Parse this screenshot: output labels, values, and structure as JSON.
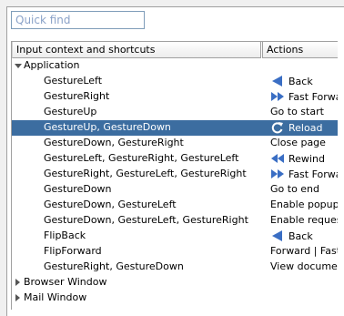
{
  "search": {
    "placeholder": "Quick find"
  },
  "columns": {
    "context": "Input context and shortcuts",
    "actions": "Actions"
  },
  "groups": {
    "application": "Application",
    "browser_window": "Browser Window",
    "mail_window": "Mail Window"
  },
  "rows": [
    {
      "gesture": "GestureLeft",
      "icon": "back-arrow-icon",
      "action": "Back"
    },
    {
      "gesture": "GestureRight",
      "icon": "fast-forward-icon",
      "action": "Fast Forward"
    },
    {
      "gesture": "GestureUp",
      "icon": "",
      "action": "Go to start"
    },
    {
      "gesture": "GestureUp, GestureDown",
      "icon": "reload-icon",
      "action": "Reload"
    },
    {
      "gesture": "GestureDown, GestureRight",
      "icon": "",
      "action": "Close page"
    },
    {
      "gesture": "GestureLeft, GestureRight, GestureLeft",
      "icon": "rewind-icon",
      "action": "Rewind"
    },
    {
      "gesture": "GestureRight, GestureLeft, GestureRight",
      "icon": "fast-forward-icon",
      "action": "Fast Forward"
    },
    {
      "gesture": "GestureDown",
      "icon": "",
      "action": "Go to end"
    },
    {
      "gesture": "GestureDown, GestureLeft",
      "icon": "",
      "action": "Enable popup"
    },
    {
      "gesture": "GestureDown, GestureLeft, GestureRight",
      "icon": "",
      "action": "Enable request"
    },
    {
      "gesture": "FlipBack",
      "icon": "back-arrow-icon",
      "action": "Back"
    },
    {
      "gesture": "FlipForward",
      "icon": "",
      "action": "Forward | Fast"
    },
    {
      "gesture": "GestureRight, GestureDown",
      "icon": "",
      "action": "View document"
    }
  ],
  "selected_row": 3,
  "colors": {
    "selection": "#3c6da0",
    "icon_blue": "#3a6ec4"
  }
}
